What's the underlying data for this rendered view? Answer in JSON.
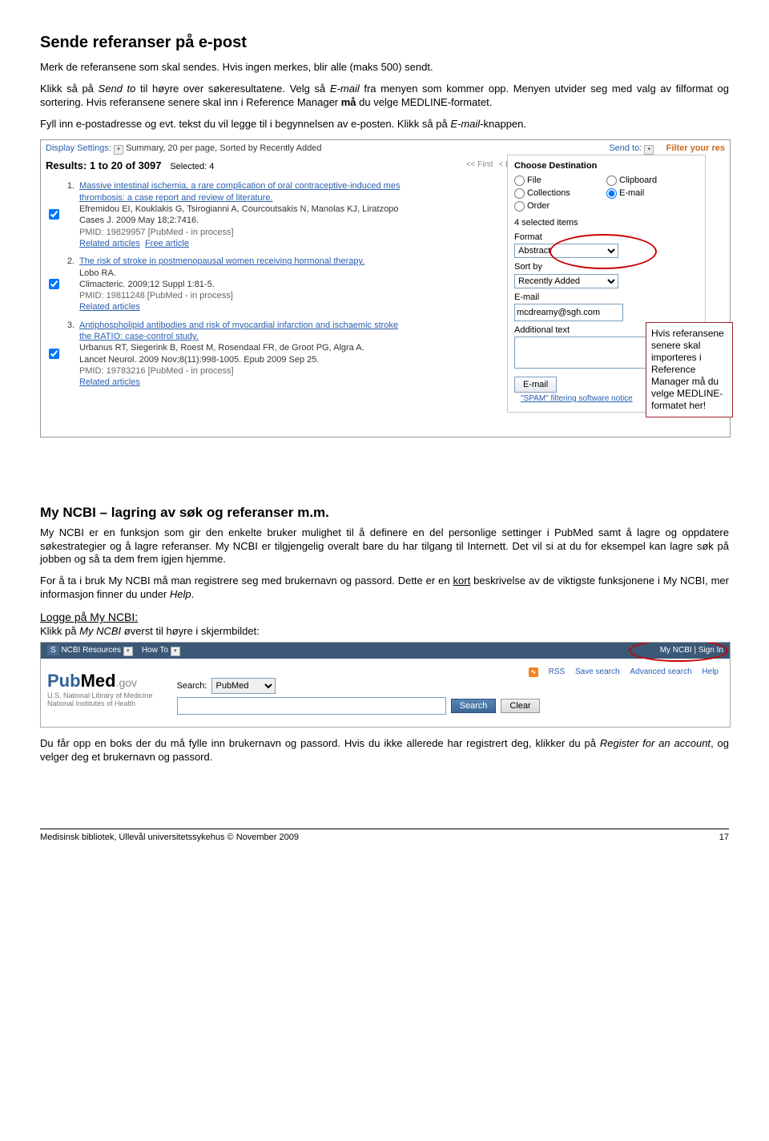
{
  "h1": "Sende referanser på e-post",
  "p1a": "Merk de referansene som skal sendes. Hvis ingen merkes, blir alle (maks 500) sendt.",
  "p1b_a": "Klikk så på ",
  "p1b_i1": "Send to",
  "p1b_b": " til høyre over søkeresultatene. Velg så ",
  "p1b_i2": "E-mail",
  "p1b_c": " fra menyen som kommer opp. Menyen utvider seg med valg av filformat og sortering. Hvis referansene senere skal inn i Reference Manager ",
  "p1b_bold": "må",
  "p1b_d": " du velge MEDLINE-formatet.",
  "p1c_a": "Fyll inn e-postadresse og evt. tekst du vil legge til i begynnelsen av e-posten. Klikk så på ",
  "p1c_i": "E-mail",
  "p1c_b": "-knappen.",
  "ss": {
    "display_settings": "Display Settings:",
    "ds_detail": "Summary, 20 per page, Sorted by Recently Added",
    "send_to": "Send to:",
    "filter": "Filter your res",
    "results_bold": "Results: 1 to 20 of 3097",
    "selected": "Selected: 4",
    "first": "<< First",
    "prev": "< Pr",
    "panel": {
      "title": "Choose Destination",
      "file": "File",
      "clipboard": "Clipboard",
      "collections": "Collections",
      "email": "E-mail",
      "order": "Order",
      "selected_items": "4 selected items",
      "format_lbl": "Format",
      "format_val": "Abstract",
      "sort_lbl": "Sort by",
      "sort_val": "Recently Added",
      "email_lbl": "E-mail",
      "email_val": "mcdreamy@sgh.com",
      "addl_lbl": "Additional text",
      "btn": "E-mail",
      "spam": "\"SPAM\" filtering software notice"
    },
    "e1": {
      "title": "Massive intestinal ischemia, a rare complication of oral contraceptive-induced mes",
      "title2": "thrombosis: a case report and review of literature.",
      "auth": "Efremidou EI, Kouklakis G, Tsirogianni A, Courcoutsakis N, Manolas KJ, Liratzopo",
      "src": "Cases J. 2009 May 18;2:7416.",
      "pmid": "PMID: 19829957  [PubMed - in process]",
      "rel": "Related articles",
      "free": "Free article"
    },
    "e2": {
      "title": "The risk of stroke in postmenopausal women receiving hormonal therapy.",
      "auth": "Lobo RA.",
      "src": "Climacteric. 2009;12 Suppl 1:81-5.",
      "pmid": "PMID: 19811248  [PubMed - in process]",
      "rel": "Related articles"
    },
    "e3": {
      "title": "Antiphospholipid antibodies and risk of myocardial infarction and ischaemic stroke",
      "title2": "the RATIO: case-control study.",
      "auth": "Urbanus RT, Siegerink B, Roest M, Rosendaal FR, de Groot PG, Algra A.",
      "src": "Lancet Neurol. 2009 Nov;8(11):998-1005. Epub 2009 Sep 25.",
      "pmid": "PMID: 19783216  [PubMed - in process]",
      "rel": "Related articles"
    }
  },
  "callout": "Hvis referansene senere skal importeres i Reference Manager må du velge MEDLINE-formatet her!",
  "h2": "My NCBI – lagring av søk og referanser m.m.",
  "p2": "My NCBI er en funksjon som gir den enkelte bruker mulighet til å definere en del personlige settinger i PubMed samt å lagre og oppdatere søkestrategier og å lagre referanser. My NCBI er tilgjengelig overalt bare du har tilgang til Internett. Det vil si at du for eksempel kan lagre søk på jobben og så ta dem frem igjen hjemme.",
  "p3a": "For å ta i bruk My NCBI må man registrere seg med brukernavn og passord. Dette er en ",
  "p3u": "kort",
  "p3b": " beskrivelse av de viktigste funksjonene i My NCBI, mer informasjon finner du under ",
  "p3i": "Help",
  "p3c": ".",
  "logon_h": "Logge på My NCBI:",
  "logon_a": "Klikk på ",
  "logon_i": "My NCBI",
  "logon_b": " øverst til høyre i skjermbildet:",
  "ncbi": {
    "left": "NCBI   Resources",
    "howto": "How To",
    "right": "My NCBI | Sign In",
    "sub1": "U.S. National Library of Medicine",
    "sub2": "National Institutes of Health",
    "search_lbl": "Search:",
    "search_sel": "PubMed",
    "rss": "RSS",
    "save": "Save search",
    "adv": "Advanced search",
    "help": "Help",
    "btn_search": "Search",
    "btn_clear": "Clear"
  },
  "p4a": "Du får opp en boks der du må fylle inn brukernavn og passord. Hvis du ikke allerede har registrert deg, klikker du på ",
  "p4i": "Register for an account",
  "p4b": ", og velger deg et brukernavn og passord.",
  "footer_left": "Medisinsk bibliotek, Ullevål universitetssykehus  ©  November 2009",
  "footer_right": "17"
}
